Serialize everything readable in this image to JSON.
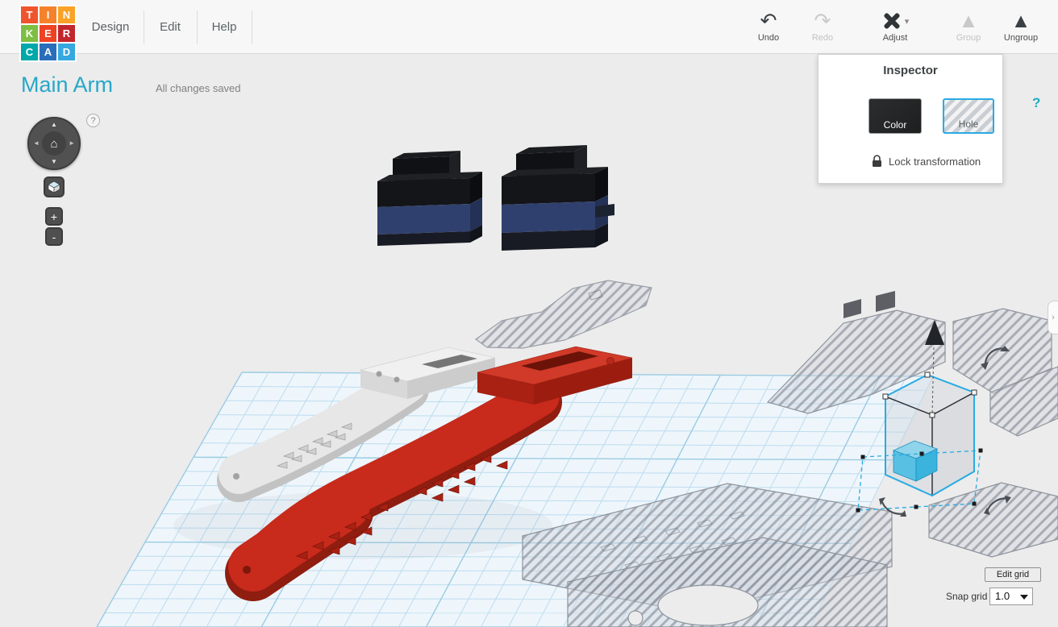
{
  "logo": {
    "tiles": [
      {
        "ch": "T",
        "bg": "#f0542c"
      },
      {
        "ch": "I",
        "bg": "#f5822a"
      },
      {
        "ch": "N",
        "bg": "#f9a227"
      },
      {
        "ch": "K",
        "bg": "#7dbf42"
      },
      {
        "ch": "E",
        "bg": "#ee4323"
      },
      {
        "ch": "R",
        "bg": "#c2272d"
      },
      {
        "ch": "C",
        "bg": "#00a8a9"
      },
      {
        "ch": "A",
        "bg": "#2a6ebb"
      },
      {
        "ch": "D",
        "bg": "#35a8e0"
      }
    ]
  },
  "menu": {
    "design": "Design",
    "edit": "Edit",
    "help": "Help"
  },
  "toolbar": {
    "undo": {
      "label": "Undo",
      "icon": "↶"
    },
    "redo": {
      "label": "Redo",
      "icon": "↷"
    },
    "adjust": {
      "label": "Adjust",
      "caret": "▾"
    },
    "group": {
      "label": "Group",
      "icon": "▲"
    },
    "ungroup": {
      "label": "Ungroup",
      "icon": "▲"
    }
  },
  "inspector": {
    "title": "Inspector",
    "color_label": "Color",
    "hole_label": "Hole",
    "help": "?",
    "lock_label": "Lock transformation"
  },
  "design": {
    "title": "Main Arm",
    "status": "All changes saved"
  },
  "nav": {
    "help_badge": "?",
    "home": "⌂",
    "up": "▲",
    "down": "▼",
    "left": "◄",
    "right": "►",
    "zoom_in": "+",
    "zoom_out": "-"
  },
  "grid_controls": {
    "edit_button": "Edit grid",
    "snap_label": "Snap grid",
    "snap_value": "1.0",
    "collapse": "›"
  },
  "colors": {
    "selection_blue": "#29abe2",
    "brand_teal": "#28a7c8",
    "red_object": "#c82a1b",
    "servo_navy": "#30406e",
    "workplane_line": "#bcdcef"
  }
}
